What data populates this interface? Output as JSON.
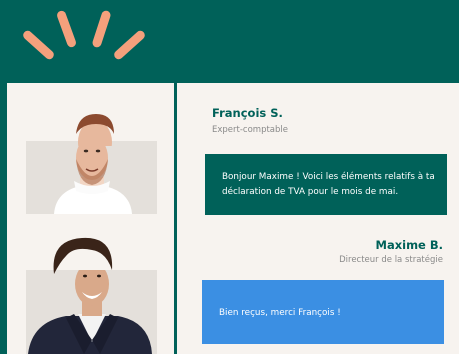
{
  "messages": [
    {
      "sender_name": "François S.",
      "sender_role": "Expert-comptable",
      "text": "Bonjour Maxime ! Voici les éléments relatifs à ta déclaration de TVA pour le mois de mai.",
      "bubble_color": "#006159"
    },
    {
      "sender_name": "Maxime B.",
      "sender_role": "Directeur de la stratégie",
      "text": "Bien reçus, merci François !",
      "bubble_color": "#3b8fe3"
    }
  ],
  "colors": {
    "brand_green": "#006159",
    "accent_orange": "#f4a07c",
    "panel_bg": "#f7f3ef"
  },
  "icons": [
    "sun-rays-icon"
  ]
}
